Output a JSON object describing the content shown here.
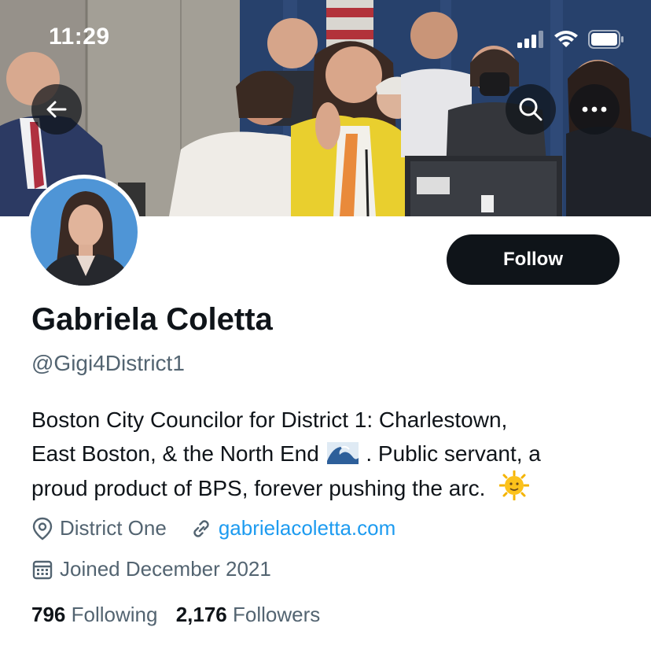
{
  "status_bar": {
    "time": "11:29"
  },
  "header": {
    "back_icon": "arrow-left-icon",
    "search_icon": "search-icon",
    "more_icon": "more-horizontal-icon"
  },
  "profile": {
    "name": "Gabriela Coletta",
    "handle": "@Gigi4District1",
    "follow_label": "Follow",
    "bio_line1": "Boston City Councilor for District 1: Charlestown,",
    "bio_line2_a": "East Boston, & the North End",
    "bio_line2_b": ". Public servant, a",
    "bio_line3": "proud product of BPS, forever pushing the arc.",
    "location": "District One",
    "website": "gabrielacoletta.com",
    "joined": "Joined December 2021",
    "following_count": "796",
    "following_label": "Following",
    "followers_count": "2,176",
    "followers_label": "Followers"
  },
  "colors": {
    "accent": "#1d9bf0",
    "text": "#0f1419",
    "secondary": "#536471"
  }
}
